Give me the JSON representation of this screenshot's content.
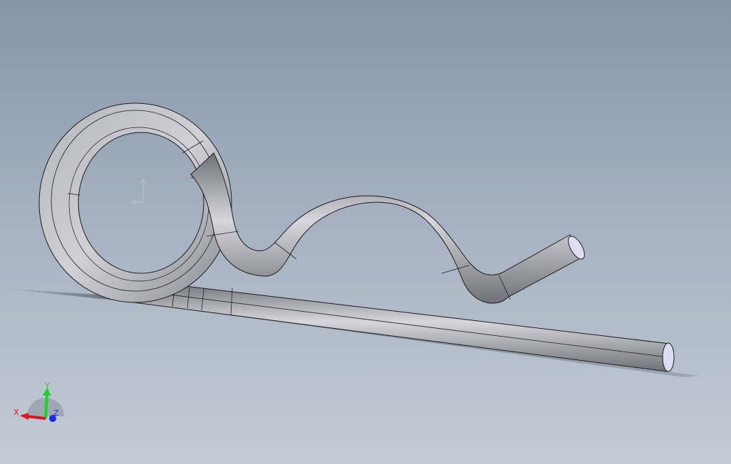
{
  "viewport": {
    "background_top": "#8695a8",
    "background_bottom": "#c3cbd5"
  },
  "part": {
    "tube_dark": "#707078",
    "tube_mid": "#a9a9b2",
    "tube_light": "#d6d6dc",
    "edge_color": "#1e1e24",
    "end_face_color": "#dcdcf2",
    "shadow_color": "#4a5260"
  },
  "triad": {
    "x_label": "X",
    "y_label": "Y",
    "z_label": "Z",
    "x_color": "#e0141e",
    "y_color": "#1fcf2a",
    "z_color": "#1a2ee0"
  },
  "origin_marker": {
    "icon": "origin-icon",
    "color": "#b8c0cc"
  }
}
